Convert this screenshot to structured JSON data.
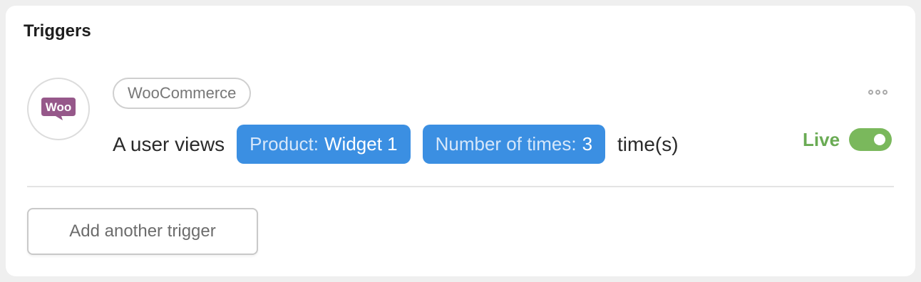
{
  "card": {
    "title": "Triggers"
  },
  "trigger": {
    "integration_label": "WooCommerce",
    "logo_text": "Woo",
    "sentence_prefix": "A user views",
    "tokens": [
      {
        "key": "Product:",
        "value": "Widget 1"
      },
      {
        "key": "Number of times:",
        "value": "3"
      }
    ],
    "sentence_suffix": "time(s)",
    "status_label": "Live",
    "status_on": true,
    "more_icon": "more-horizontal-icon"
  },
  "actions": {
    "add_trigger_label": "Add another trigger"
  },
  "colors": {
    "token_bg": "#3b8fe2",
    "live_green": "#6aab54",
    "toggle_green": "#7ab85c",
    "woo_purple": "#96588a"
  }
}
